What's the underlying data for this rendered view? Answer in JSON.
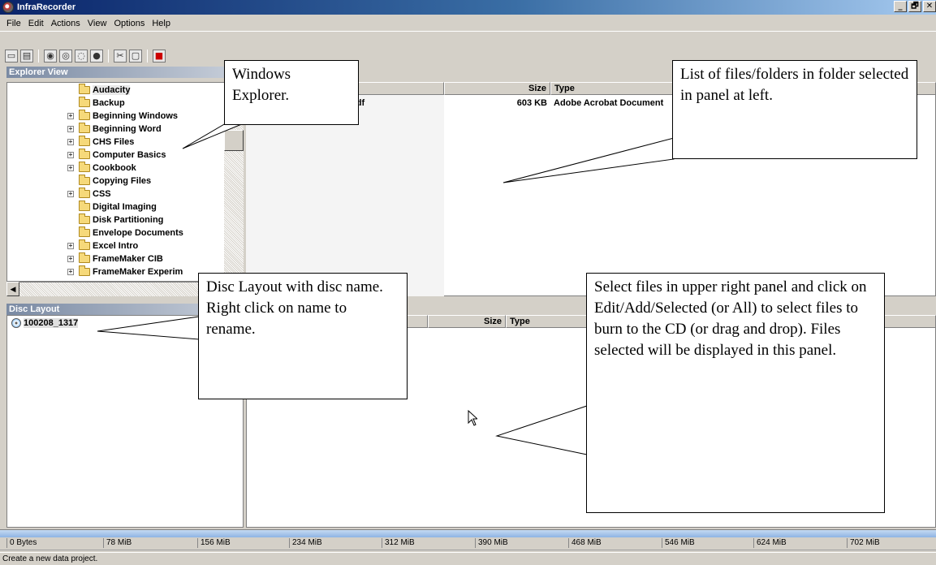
{
  "window": {
    "title": "InfraRecorder",
    "min_label": "_",
    "max_label": "🗗",
    "close_label": "✕"
  },
  "menu": [
    "File",
    "Edit",
    "Actions",
    "View",
    "Options",
    "Help"
  ],
  "explorer_panel": {
    "header": "Explorer View",
    "tree": [
      {
        "label": "Audacity",
        "expandable": false
      },
      {
        "label": "Backup",
        "expandable": false
      },
      {
        "label": "Beginning Windows",
        "expandable": true
      },
      {
        "label": "Beginning Word",
        "expandable": true
      },
      {
        "label": "CHS Files",
        "expandable": true
      },
      {
        "label": "Computer Basics",
        "expandable": true
      },
      {
        "label": "Cookbook",
        "expandable": true
      },
      {
        "label": "Copying Files",
        "expandable": false
      },
      {
        "label": "CSS",
        "expandable": true
      },
      {
        "label": "Digital Imaging",
        "expandable": false
      },
      {
        "label": "Disk Partitioning",
        "expandable": false
      },
      {
        "label": "Envelope Documents",
        "expandable": false
      },
      {
        "label": "Excel Intro",
        "expandable": true
      },
      {
        "label": "FrameMaker CIB",
        "expandable": true
      },
      {
        "label": "FrameMaker Experim",
        "expandable": true
      }
    ]
  },
  "file_list": {
    "columns": {
      "size": "Size",
      "type": "Type"
    },
    "row": {
      "name_fragment": "pdf",
      "size": "603 KB",
      "type": "Adobe Acrobat Document"
    }
  },
  "disc_panel": {
    "header": "Disc Layout",
    "disc_name": "100208_1317",
    "columns": {
      "size": "Size",
      "type": "Type"
    }
  },
  "size_scale": [
    "0 Bytes",
    "78 MiB",
    "156 MiB",
    "234 MiB",
    "312 MiB",
    "390 MiB",
    "468 MiB",
    "546 MiB",
    "624 MiB",
    "702 MiB"
  ],
  "status": "Create a new data project.",
  "callouts": {
    "explorer": "Windows Explorer.",
    "file_list": "List of files/folders in folder selected in panel at left.",
    "disc_layout": "Disc Layout with disc name.  Right click on name to rename.",
    "select_files": "Select files in upper right panel and click on Edit/Add/Selected (or All) to select files to burn to the CD (or drag and drop). Files selected will be displayed in this panel."
  }
}
